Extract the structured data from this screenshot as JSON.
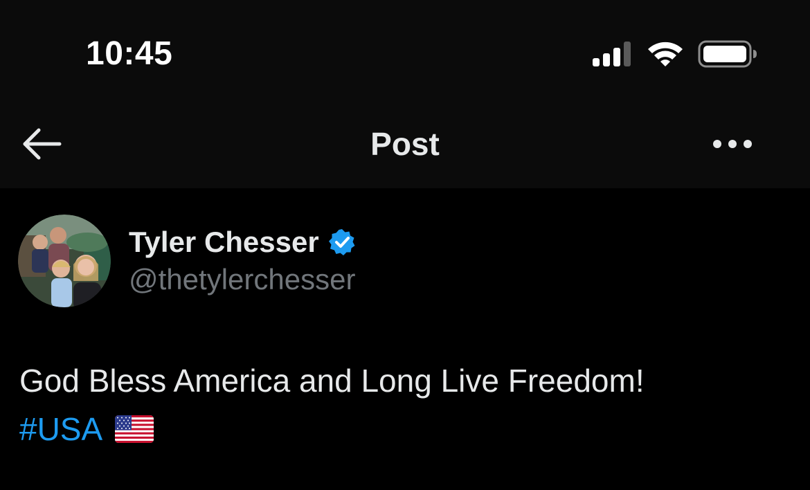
{
  "status_bar": {
    "time": "10:45",
    "icons": [
      "signal-icon",
      "wifi-icon",
      "battery-icon"
    ]
  },
  "header": {
    "title": "Post",
    "back_icon": "back-arrow-icon",
    "more_icon": "more-icon"
  },
  "author": {
    "display_name": "Tyler Chesser",
    "handle": "@thetylerchesser",
    "verified": true,
    "verified_icon": "verified-badge-icon"
  },
  "post": {
    "text": "God Bless America and Long Live Freedom!",
    "hashtag": "#USA",
    "emoji": "us-flag-emoji"
  },
  "colors": {
    "background": "#000000",
    "header_background": "#0b0b0b",
    "primary_text": "#e7e9ea",
    "secondary_text": "#71767b",
    "accent": "#1d9bf0"
  }
}
